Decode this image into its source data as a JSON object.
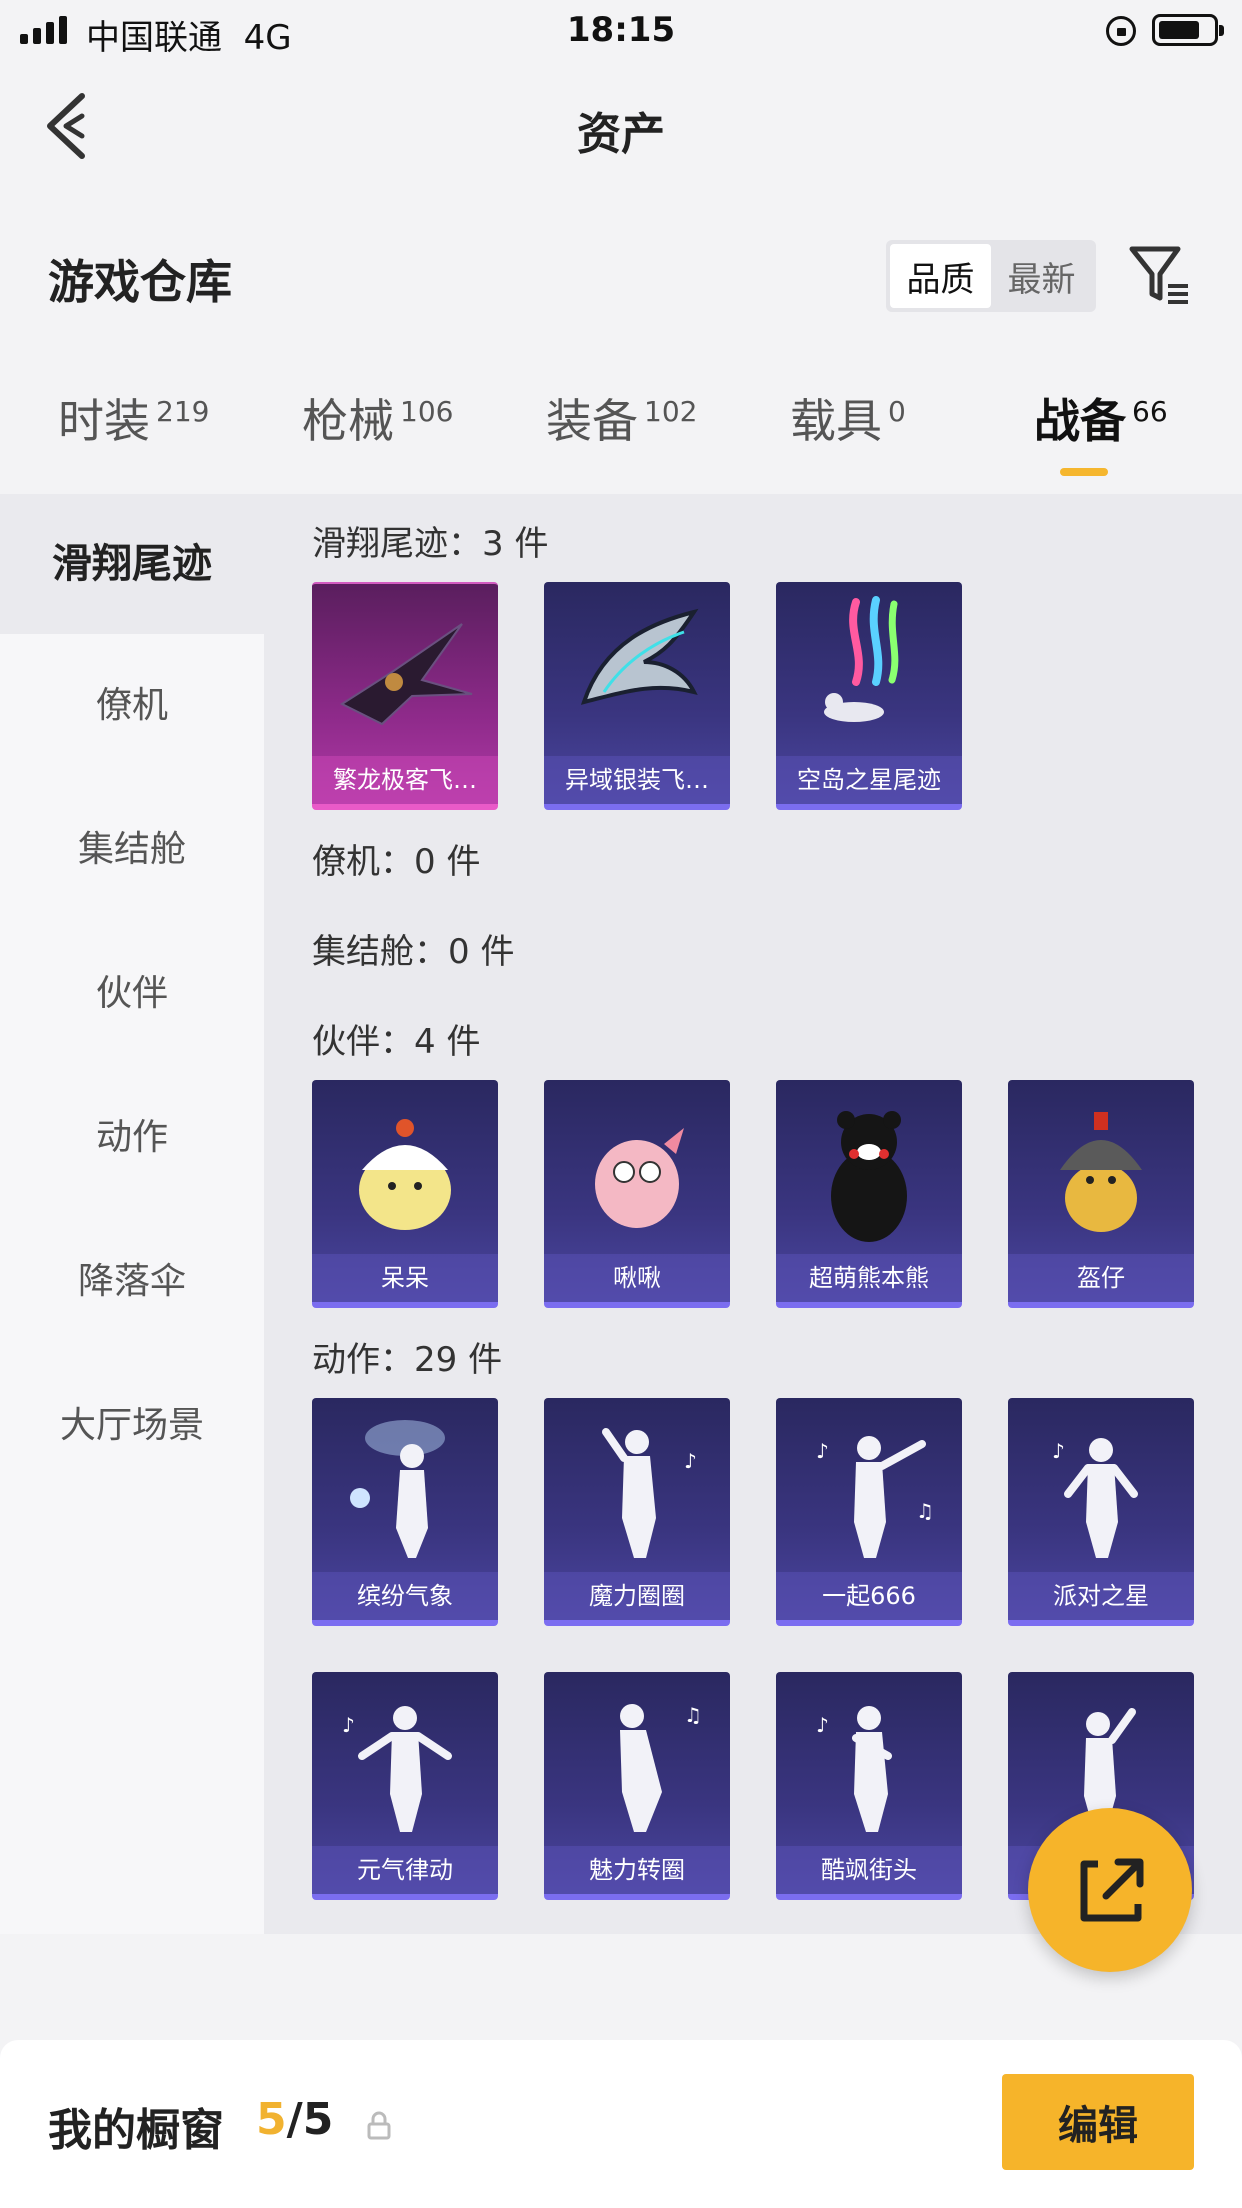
{
  "status_bar": {
    "carrier": "中国联通",
    "network": "4G",
    "time": "18:15"
  },
  "header": {
    "title": "资产"
  },
  "warehouse": {
    "title": "游戏仓库",
    "sort_options": [
      "品质",
      "最新"
    ],
    "sort_selected": "品质"
  },
  "tabs": [
    {
      "label": "时装",
      "count": "219"
    },
    {
      "label": "枪械",
      "count": "106"
    },
    {
      "label": "装备",
      "count": "102"
    },
    {
      "label": "载具",
      "count": "0"
    },
    {
      "label": "战备",
      "count": "66",
      "active": true
    }
  ],
  "sidebar": {
    "items": [
      "滑翔尾迹",
      "僚机",
      "集结舱",
      "伙伴",
      "动作",
      "降落伞",
      "大厅场景"
    ],
    "active": "滑翔尾迹"
  },
  "sections": {
    "glide": {
      "title": "滑翔尾迹：3 件",
      "items": [
        "繁龙极客飞…",
        "异域银装飞…",
        "空岛之星尾迹"
      ]
    },
    "wingman": {
      "title": "僚机：0 件"
    },
    "rally": {
      "title": "集结舱：0 件"
    },
    "partner": {
      "title": "伙伴：4 件",
      "items": [
        "呆呆",
        "啾啾",
        "超萌熊本熊",
        "盔仔"
      ]
    },
    "emote": {
      "title": "动作：29 件",
      "items": [
        "缤纷气象",
        "魔力圈圈",
        "一起666",
        "派对之星",
        "元气律动",
        "魅力转圈",
        "酷飒街头",
        ""
      ]
    }
  },
  "showcase": {
    "title": "我的橱窗",
    "current": "5",
    "separator": "/",
    "total": "5",
    "edit_label": "编辑"
  },
  "colors": {
    "accent": "#f6b42a",
    "card_purple": "#3a3580",
    "card_pink": "#8e2a8a"
  }
}
